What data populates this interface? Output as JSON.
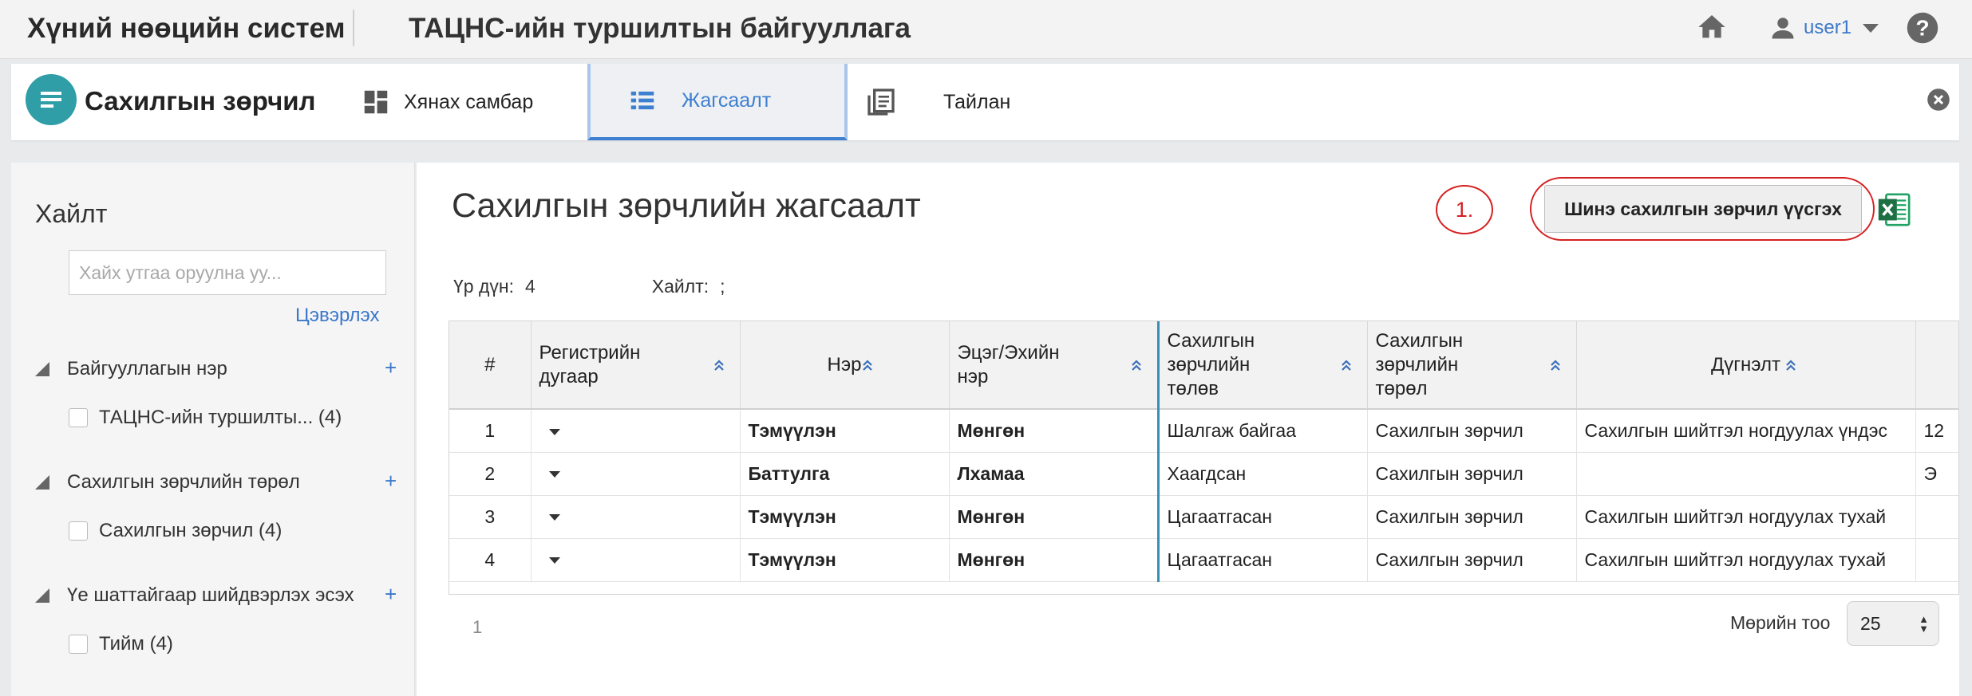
{
  "topbar": {
    "app_title": "Хүний нөөцийн систем",
    "org_title": "ТАЦНС-ийн туршилтын байгууллага",
    "user": "user1"
  },
  "module": {
    "title": "Сахилгын зөрчил",
    "tabs": [
      {
        "label": "Хянах самбар",
        "icon": "dashboard-icon"
      },
      {
        "label": "Жагсаалт",
        "icon": "list-icon",
        "active": true
      },
      {
        "label": "Тайлан",
        "icon": "report-icon"
      }
    ]
  },
  "sidebar": {
    "title": "Хайлт",
    "search_placeholder": "Хайх утгаа оруулна уу...",
    "clear_label": "Цэвэрлэх",
    "facets": [
      {
        "label": "Байгууллагын нэр",
        "option": "ТАЦНС-ийн туршилты... (4)"
      },
      {
        "label": "Сахилгын зөрчлийн төрөл",
        "option": "Сахилгын зөрчил (4)"
      },
      {
        "label": "Үе шаттайгаар шийдвэрлэх эсэх",
        "option": "Тийм (4)"
      }
    ]
  },
  "main": {
    "title": "Сахилгын зөрчлийн жагсаалт",
    "annotation": "1.",
    "new_button": "Шинэ сахилгын зөрчил үүсгэх",
    "result_label": "Үр дүн:",
    "result_value": "4",
    "search_label": "Хайлт:",
    "search_value": ";",
    "columns": [
      "#",
      "Регистрийн дугаар",
      "Нэр",
      "Эцэг/Эхийн нэр",
      "Сахилгын зөрчлийн төлөв",
      "Сахилгын зөрчлийн төрөл",
      "Дүгнэлт"
    ],
    "rows": [
      {
        "num": "1",
        "name": "Тэмүүлэн",
        "parent": "Мөнгөн",
        "status": "Шалгаж байгаа",
        "type": "Сахилгын зөрчил",
        "conclusion": "Сахилгын шийтгэл ногдуулах үндэс",
        "extra": "12"
      },
      {
        "num": "2",
        "name": "Баттулга",
        "parent": "Лхамаа",
        "status": "Хаагдсан",
        "type": "Сахилгын зөрчил",
        "conclusion": "",
        "extra": "Э"
      },
      {
        "num": "3",
        "name": "Тэмүүлэн",
        "parent": "Мөнгөн",
        "status": "Цагаатгасан",
        "type": "Сахилгын зөрчил",
        "conclusion": "Сахилгын шийтгэл ногдуулах тухай",
        "extra": ""
      },
      {
        "num": "4",
        "name": "Тэмүүлэн",
        "parent": "Мөнгөн",
        "status": "Цагаатгасан",
        "type": "Сахилгын зөрчил",
        "conclusion": "Сахилгын шийтгэл ногдуулах тухай",
        "extra": ""
      }
    ],
    "page": "1",
    "per_page_label": "Мөрийн тоо",
    "per_page_value": "25"
  },
  "colors": {
    "accent": "#3d7fd0",
    "logo": "#2f9ea6",
    "annotation": "#d62020"
  }
}
